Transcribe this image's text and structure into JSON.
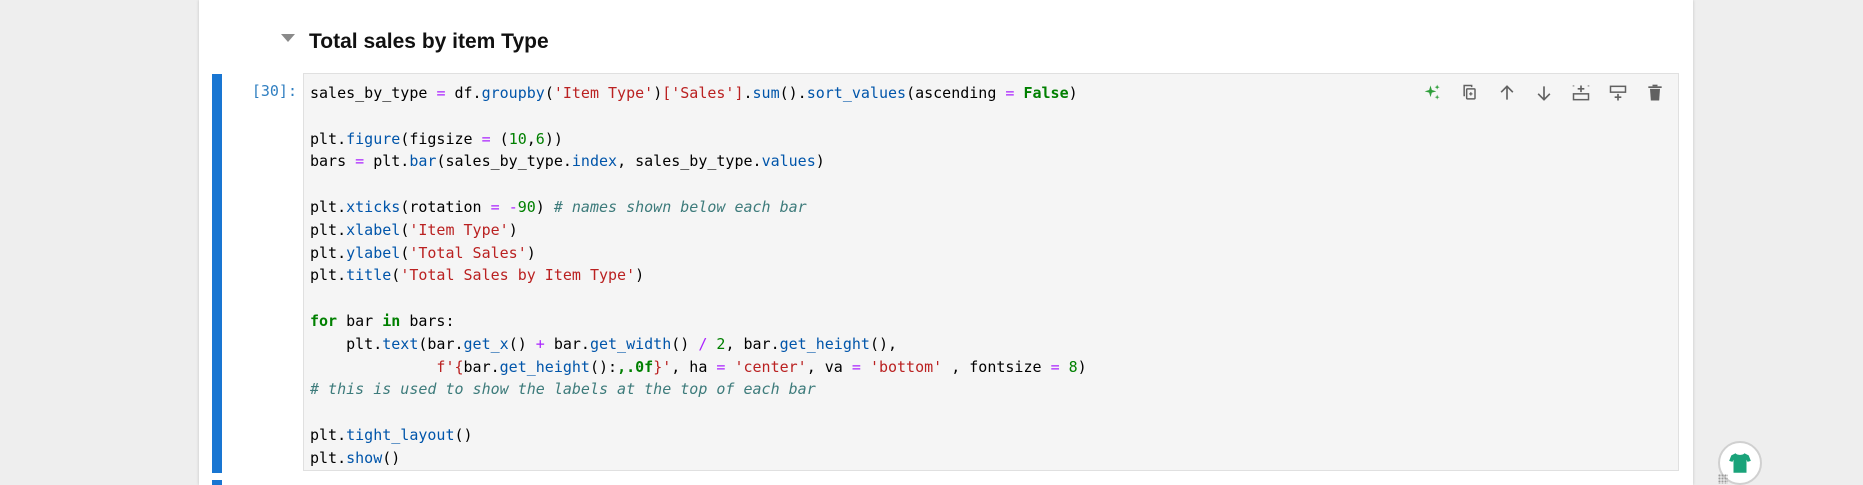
{
  "heading": {
    "title": "Total sales by item Type"
  },
  "cell": {
    "prompt": "[30]:",
    "code_lines": [
      [
        {
          "t": "sales_by_type "
        },
        {
          "t": "=",
          "c": "o"
        },
        {
          "t": " df."
        },
        {
          "t": "groupby",
          "c": "a"
        },
        {
          "t": "("
        },
        {
          "t": "'Item Type'",
          "c": "s"
        },
        {
          "t": ")"
        },
        {
          "t": "['Sales']",
          "c": "s"
        },
        {
          "t": "."
        },
        {
          "t": "sum",
          "c": "a"
        },
        {
          "t": "()."
        },
        {
          "t": "sort_values",
          "c": "a"
        },
        {
          "t": "(ascending "
        },
        {
          "t": "=",
          "c": "o"
        },
        {
          "t": " "
        },
        {
          "t": "False",
          "c": "k"
        },
        {
          "t": ")"
        }
      ],
      [],
      [
        {
          "t": "plt."
        },
        {
          "t": "figure",
          "c": "a"
        },
        {
          "t": "(figsize "
        },
        {
          "t": "=",
          "c": "o"
        },
        {
          "t": " ("
        },
        {
          "t": "10",
          "c": "n"
        },
        {
          "t": ","
        },
        {
          "t": "6",
          "c": "n"
        },
        {
          "t": "))"
        }
      ],
      [
        {
          "t": "bars "
        },
        {
          "t": "=",
          "c": "o"
        },
        {
          "t": " plt."
        },
        {
          "t": "bar",
          "c": "a"
        },
        {
          "t": "(sales_by_type."
        },
        {
          "t": "index",
          "c": "a"
        },
        {
          "t": ", sales_by_type."
        },
        {
          "t": "values",
          "c": "a"
        },
        {
          "t": ")"
        }
      ],
      [],
      [
        {
          "t": "plt."
        },
        {
          "t": "xticks",
          "c": "a"
        },
        {
          "t": "(rotation "
        },
        {
          "t": "=",
          "c": "o"
        },
        {
          "t": " "
        },
        {
          "t": "-",
          "c": "o"
        },
        {
          "t": "90",
          "c": "n"
        },
        {
          "t": ") "
        },
        {
          "t": "# names shown below each bar",
          "c": "c"
        }
      ],
      [
        {
          "t": "plt."
        },
        {
          "t": "xlabel",
          "c": "a"
        },
        {
          "t": "("
        },
        {
          "t": "'Item Type'",
          "c": "s"
        },
        {
          "t": ")"
        }
      ],
      [
        {
          "t": "plt."
        },
        {
          "t": "ylabel",
          "c": "a"
        },
        {
          "t": "("
        },
        {
          "t": "'Total Sales'",
          "c": "s"
        },
        {
          "t": ")"
        }
      ],
      [
        {
          "t": "plt."
        },
        {
          "t": "title",
          "c": "a"
        },
        {
          "t": "("
        },
        {
          "t": "'Total Sales by Item Type'",
          "c": "s"
        },
        {
          "t": ")"
        }
      ],
      [],
      [
        {
          "t": "for",
          "c": "k"
        },
        {
          "t": " bar "
        },
        {
          "t": "in",
          "c": "k"
        },
        {
          "t": " bars:"
        }
      ],
      [
        {
          "t": "    plt."
        },
        {
          "t": "text",
          "c": "a"
        },
        {
          "t": "(bar."
        },
        {
          "t": "get_x",
          "c": "a"
        },
        {
          "t": "() "
        },
        {
          "t": "+",
          "c": "o"
        },
        {
          "t": " bar."
        },
        {
          "t": "get_width",
          "c": "a"
        },
        {
          "t": "() "
        },
        {
          "t": "/",
          "c": "o"
        },
        {
          "t": " "
        },
        {
          "t": "2",
          "c": "n"
        },
        {
          "t": ", bar."
        },
        {
          "t": "get_height",
          "c": "a"
        },
        {
          "t": "(),"
        }
      ],
      [
        {
          "t": "              f'",
          "c": "s"
        },
        {
          "t": "{",
          "c": "s"
        },
        {
          "t": "bar."
        },
        {
          "t": "get_height",
          "c": "a"
        },
        {
          "t": "():"
        },
        {
          "t": ",.0f",
          "c": "k"
        },
        {
          "t": "}'",
          "c": "s"
        },
        {
          "t": ", ha "
        },
        {
          "t": "=",
          "c": "o"
        },
        {
          "t": " "
        },
        {
          "t": "'center'",
          "c": "s"
        },
        {
          "t": ", va "
        },
        {
          "t": "=",
          "c": "o"
        },
        {
          "t": " "
        },
        {
          "t": "'bottom'",
          "c": "s"
        },
        {
          "t": " , fontsize "
        },
        {
          "t": "=",
          "c": "o"
        },
        {
          "t": " "
        },
        {
          "t": "8",
          "c": "n"
        },
        {
          "t": ")"
        }
      ],
      [
        {
          "t": "# this is used to show the labels at the top of each bar",
          "c": "c"
        }
      ],
      [],
      [
        {
          "t": "plt."
        },
        {
          "t": "tight_layout",
          "c": "a"
        },
        {
          "t": "()"
        }
      ],
      [
        {
          "t": "plt."
        },
        {
          "t": "show",
          "c": "a"
        },
        {
          "t": "()"
        }
      ]
    ]
  },
  "toolbar": {
    "buttons": [
      {
        "name": "generate-sparkle-icon",
        "icon": "sparkle",
        "color": "#2e9e3a"
      },
      {
        "name": "duplicate-cell-icon",
        "icon": "copy",
        "color": "#616161"
      },
      {
        "name": "move-up-icon",
        "icon": "arrow-up",
        "color": "#616161"
      },
      {
        "name": "move-down-icon",
        "icon": "arrow-down",
        "color": "#616161"
      },
      {
        "name": "insert-above-icon",
        "icon": "insert-above",
        "color": "#616161"
      },
      {
        "name": "insert-below-icon",
        "icon": "insert-below",
        "color": "#616161"
      },
      {
        "name": "delete-cell-icon",
        "icon": "trash",
        "color": "#616161"
      }
    ]
  },
  "colors": {
    "active_cell_bar": "#1976d2",
    "prompt": "#307fc1",
    "editor_bg": "#f5f5f5",
    "badge_shirt": "#1aa37a"
  }
}
